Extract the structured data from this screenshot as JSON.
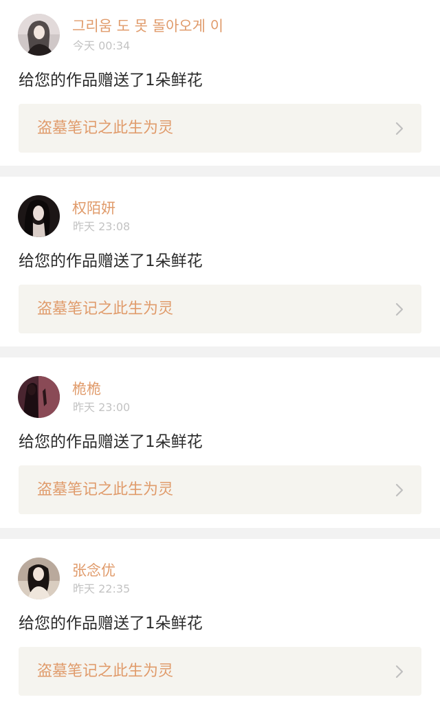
{
  "colors": {
    "accent_orange": "#e09b6b",
    "timestamp_gray": "#c3c3c3",
    "message_text": "#2b2b2b",
    "link_bg": "#f5f4ef",
    "divider_bg": "#f2f2f2",
    "chevron_gray": "#bfbfbf"
  },
  "notifications": [
    {
      "username": "그리움 도 못 돌아오게 이",
      "time": "今天 00:34",
      "message": "给您的作品赠送了1朵鲜花",
      "work_title": "盗墓笔记之此生为灵",
      "avatar_icon": "avatar-photo",
      "chevron_icon": "chevron-right-icon"
    },
    {
      "username": "权陌妍",
      "time": "昨天 23:08",
      "message": "给您的作品赠送了1朵鲜花",
      "work_title": "盗墓笔记之此生为灵",
      "avatar_icon": "avatar-photo",
      "chevron_icon": "chevron-right-icon"
    },
    {
      "username": "桅桅",
      "time": "昨天 23:00",
      "message": "给您的作品赠送了1朵鲜花",
      "work_title": "盗墓笔记之此生为灵",
      "avatar_icon": "avatar-photo",
      "chevron_icon": "chevron-right-icon"
    },
    {
      "username": "张念优",
      "time": "昨天 22:35",
      "message": "给您的作品赠送了1朵鲜花",
      "work_title": "盗墓笔记之此生为灵",
      "avatar_icon": "avatar-photo",
      "chevron_icon": "chevron-right-icon"
    }
  ]
}
